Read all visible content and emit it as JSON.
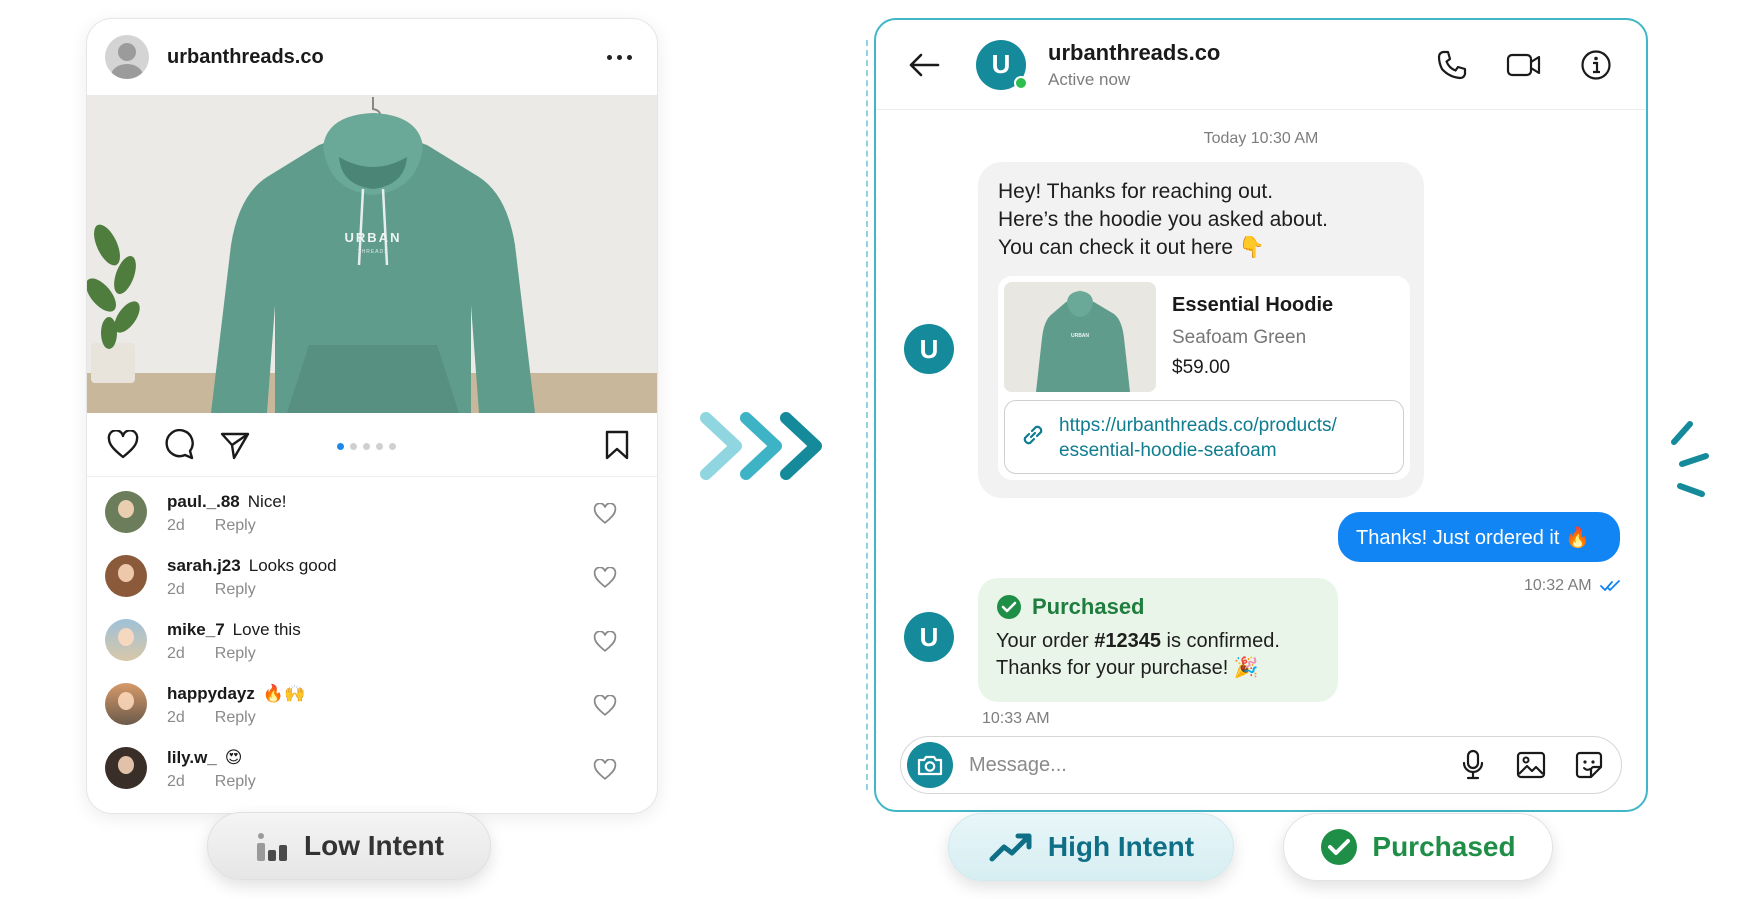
{
  "post": {
    "username": "urbanthreads.co",
    "image_alt": "Green hoodie on hanger",
    "hoodie_brand": "URBAN",
    "hoodie_sub": "THREADS",
    "carousel": {
      "count": 5,
      "active": 1
    },
    "comments": [
      {
        "user": "paul._.88",
        "text": "Nice!",
        "time": "2d",
        "reply": "Reply"
      },
      {
        "user": "sarah.j23",
        "text": "Looks good",
        "time": "2d",
        "reply": "Reply"
      },
      {
        "user": "mike_7",
        "text": "Love this",
        "time": "2d",
        "reply": "Reply"
      },
      {
        "user": "happydayz",
        "text": "🔥🙌",
        "time": "2d",
        "reply": "Reply"
      },
      {
        "user": "lily.w_",
        "text": "😍",
        "time": "2d",
        "reply": "Reply"
      }
    ]
  },
  "badges": {
    "low": "Low Intent",
    "high": "High Intent",
    "purchased": "Purchased"
  },
  "dm": {
    "name": "urbanthreads.co",
    "status": "Active now",
    "avatar_letter": "U",
    "timestamp": "Today 10:30 AM",
    "message1": {
      "line1": "Hey! Thanks for reaching out.",
      "line2": "Here’s the hoodie you asked about.",
      "line3": "You can check it out here 👇"
    },
    "product": {
      "title": "Essential Hoodie",
      "color": "Seafoam Green",
      "price": "$59.00",
      "url_line1": "https://urbanthreads.co/products/",
      "url_line2": "essential-hoodie-seafoam"
    },
    "reply": {
      "text": "Thanks! Just ordered it 🔥",
      "time": "10:32 AM"
    },
    "confirmation": {
      "title": "Purchased",
      "line1_pre": "Your order ",
      "order": "#12345",
      "line1_post": " is confirmed.",
      "line2": "Thanks for your purchase! 🎉",
      "time": "10:33 AM"
    },
    "composer_placeholder": "Message..."
  },
  "colors": {
    "teal": "#148a9a",
    "teal_border": "#41b6c7",
    "blue_bubble": "#1285f5",
    "green": "#1f8f47",
    "hoodie": "#5f9c8c"
  }
}
